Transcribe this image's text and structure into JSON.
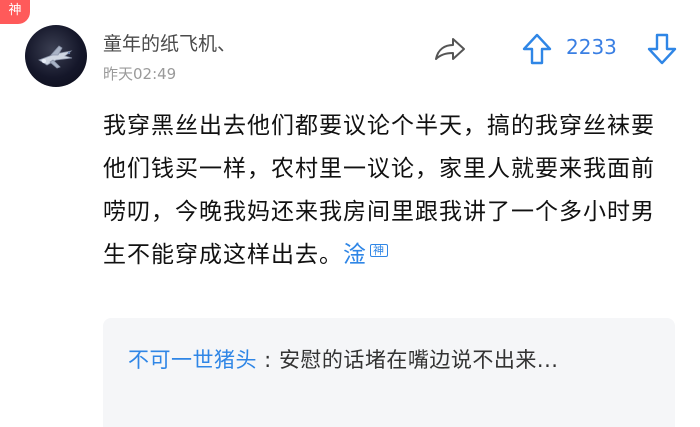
{
  "badge": "神",
  "post": {
    "username": "童年的纸飞机、",
    "timestamp": "昨天02:49",
    "vote_count": "2233",
    "content": "我穿黑丝出去他们都要议论个半天，搞的我穿丝袜要他们钱买一样，农村里一议论，家里人就要来我面前唠叨，今晚我妈还来我房间里跟我讲了一个多小时男生不能穿成这样出去。",
    "god_tag": "淦"
  },
  "reply": {
    "author": "不可一世猪头",
    "separator": " : ",
    "text": "安慰的话堵在嘴边说不出来..."
  },
  "colors": {
    "accent": "#2f86e6",
    "badge": "#ff5a5a"
  },
  "icons": {
    "share": "share-arrow-icon",
    "upvote": "up-arrow-icon",
    "downvote": "down-arrow-icon"
  }
}
